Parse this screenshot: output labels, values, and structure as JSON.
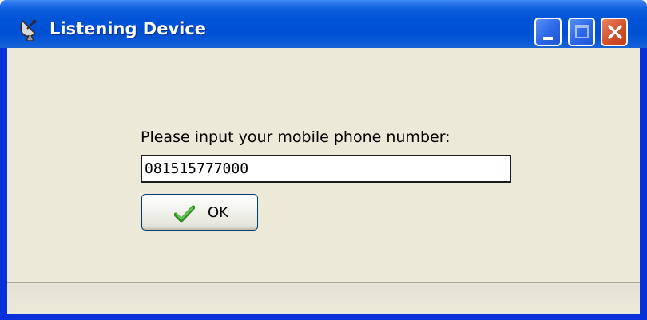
{
  "window": {
    "title": "Listening Device",
    "title_color": "#ffffff",
    "titlebar_color": "#0052d6"
  },
  "icons": {
    "app": "satellite-dish-icon",
    "minimize": "minimize-icon",
    "maximize": "maximize-icon",
    "close": "close-icon",
    "ok": "checkmark-icon"
  },
  "form": {
    "prompt": "Please input your mobile phone number:",
    "phone_value": "081515777000",
    "ok_label": "OK"
  },
  "colors": {
    "client_background": "#ece9d8",
    "close_button": "#d4502c",
    "checkmark": "#3aa529"
  }
}
